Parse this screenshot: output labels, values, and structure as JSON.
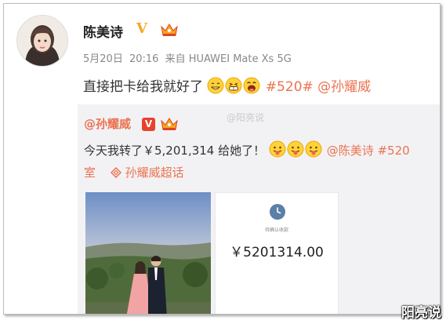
{
  "post": {
    "username": "陈美诗",
    "verified_badge": "V",
    "meta": {
      "date": "5月20日",
      "time": "20:16",
      "source": "来自 HUAWEI Mate Xs 5G"
    },
    "text": "直接把卡给我就好了",
    "topic": "#520#",
    "mention": "@孙耀威"
  },
  "repost": {
    "username": "@孙耀威",
    "verified_badge": "V",
    "text": "今天我转了￥5,201,314 给她了！",
    "mention": "@陈美诗",
    "topic_cut": "#520",
    "line2_start": "室",
    "supertopic": "孙耀威超话",
    "watermark": "@阳亮说",
    "receipt": {
      "caption": "待确认收款",
      "amount": "￥5201314.00"
    }
  },
  "corner_watermark": "阳亮说",
  "colors": {
    "link": "#eb7350",
    "verified_gold": "#f5a623",
    "verified_red": "#e8412c"
  }
}
